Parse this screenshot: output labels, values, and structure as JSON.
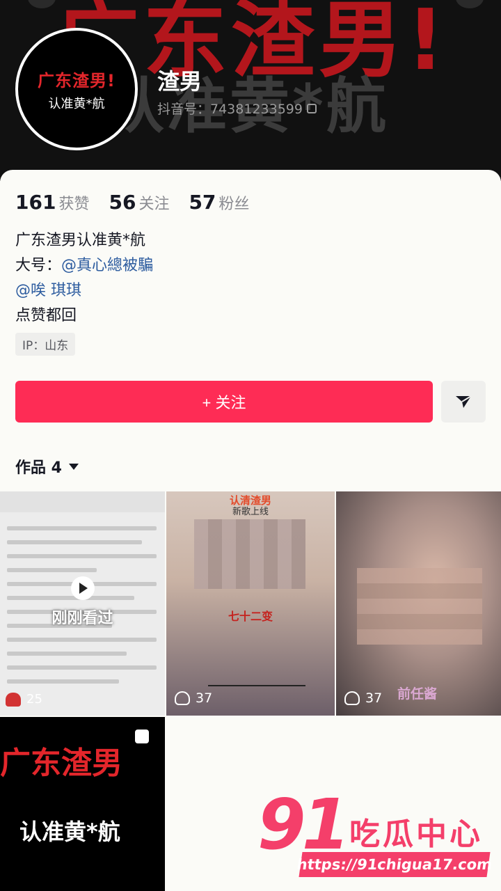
{
  "banner": {
    "bg_text_1": "广东渣男!",
    "bg_text_2": "认准黄*航"
  },
  "avatar": {
    "line1": "广东渣男!",
    "line2": "认准黄*航"
  },
  "profile": {
    "nickname": "渣男",
    "douyin_id": "抖音号：74381233599"
  },
  "stats": [
    {
      "num": "161",
      "label": "获赞"
    },
    {
      "num": "56",
      "label": "关注"
    },
    {
      "num": "57",
      "label": "粉丝"
    }
  ],
  "bio": {
    "line1": "广东渣男认准黄*航",
    "line2_prefix": "大号：",
    "line2_mention": "@真心總被騙",
    "line3_mention": "@唉 琪琪",
    "line4": "点赞都回"
  },
  "ip_tag": "IP：山东",
  "follow_button": "+ 关注",
  "works_tab": "作品 4",
  "grid": {
    "tile1": {
      "overlay": "刚刚看过",
      "likes": "25"
    },
    "tile2": {
      "top_caption": "认清渣男",
      "sub_caption": "新歌上线",
      "center_caption": "七十二变",
      "likes": "37"
    },
    "tile3": {
      "caption": "前任酱",
      "likes": "37"
    },
    "tile4": {
      "line1": "广东渣男",
      "line2": "认准黄*航"
    }
  },
  "watermark": {
    "num": "91",
    "text": "吃瓜中心",
    "url": "https://91chigua17.com"
  },
  "colors": {
    "accent": "#fe2c55",
    "mention": "#2d5c9f",
    "watermark": "#f43f6a"
  }
}
